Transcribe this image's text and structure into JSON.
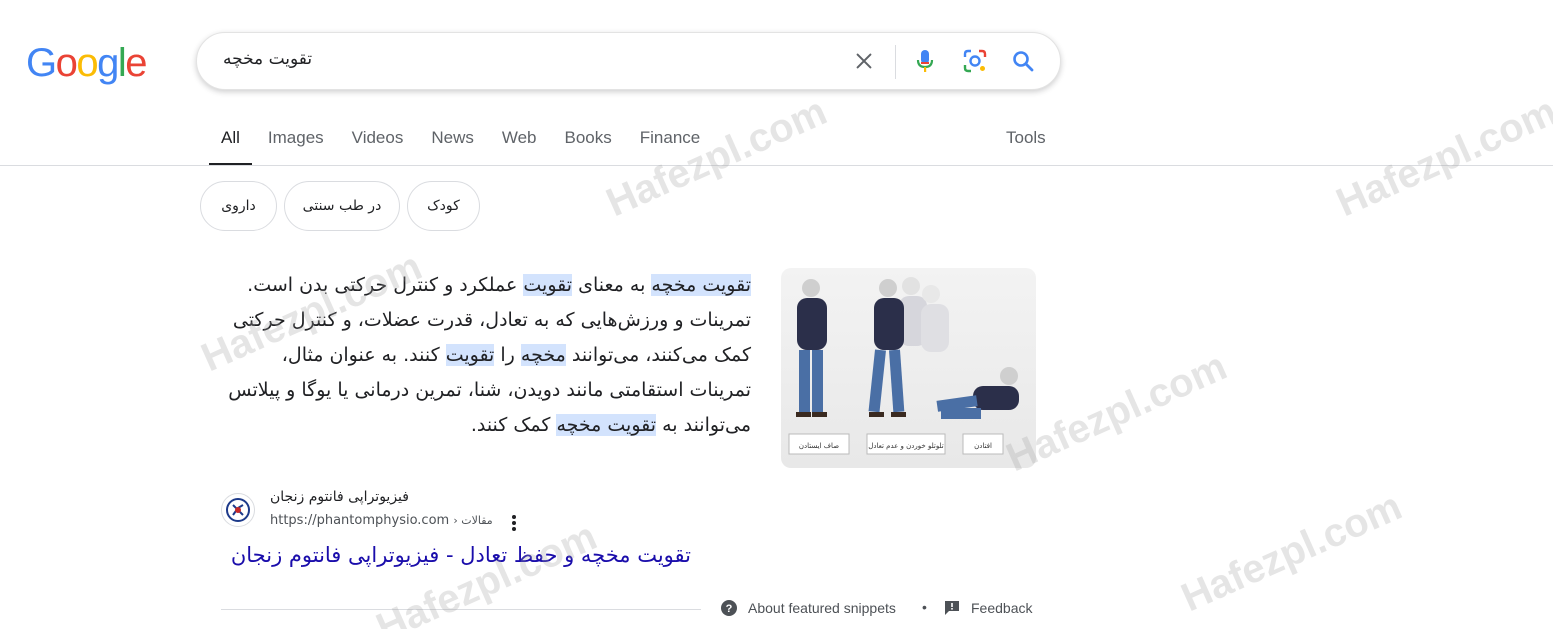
{
  "logo": {
    "letters": [
      "G",
      "o",
      "o",
      "g",
      "l",
      "e"
    ],
    "colors": [
      "#4285F4",
      "#EA4335",
      "#FBBC05",
      "#4285F4",
      "#34A853",
      "#EA4335"
    ]
  },
  "search": {
    "query": "تقویت مخچه"
  },
  "tabs": [
    {
      "label": "All",
      "active": true
    },
    {
      "label": "Images"
    },
    {
      "label": "Videos"
    },
    {
      "label": "News"
    },
    {
      "label": "Web"
    },
    {
      "label": "Books"
    },
    {
      "label": "Finance"
    }
  ],
  "tools_label": "Tools",
  "chips": [
    "داروی",
    "در طب سنتی",
    "کودک"
  ],
  "snippet": {
    "segments": [
      {
        "text": "تقویت مخچه",
        "hl": true
      },
      {
        "text": " به معنای "
      },
      {
        "text": "تقویت",
        "hl": true
      },
      {
        "text": " عملکرد و کنترل حرکتی بدن است. تمرینات و ورزش‌هایی که به تعادل، قدرت عضلات، و کنترل حرکتی کمک می‌کنند، می‌توانند "
      },
      {
        "text": "مخچه",
        "hl": true
      },
      {
        "text": " را "
      },
      {
        "text": "تقویت",
        "hl": true
      },
      {
        "text": " کنند. به عنوان مثال، تمرینات استقامتی مانند دویدن، شنا، تمرین درمانی یا یوگا و پیلاتس می‌توانند به "
      },
      {
        "text": "تقویت مخچه",
        "hl": true
      },
      {
        "text": " کمک کنند."
      }
    ]
  },
  "image": {
    "captions": [
      "صاف ایستادن",
      "تلوتلو خوردن و عدم تعادل",
      "افتادن"
    ]
  },
  "source": {
    "name": "فیزیوتراپی فانتوم زنجان",
    "url": "https://phantomphysio.com",
    "path": "› مقالات"
  },
  "result_title": "تقویت مخچه و حفظ تعادل - فیزیوتراپی فانتوم زنجان",
  "footer": {
    "about": "About featured snippets",
    "dot": "•",
    "feedback": "Feedback"
  },
  "watermark": "Hafezpl.com",
  "colors": {
    "link": "#1a0dab",
    "highlight": "#d3e3fd",
    "tab_active": "#202124"
  }
}
